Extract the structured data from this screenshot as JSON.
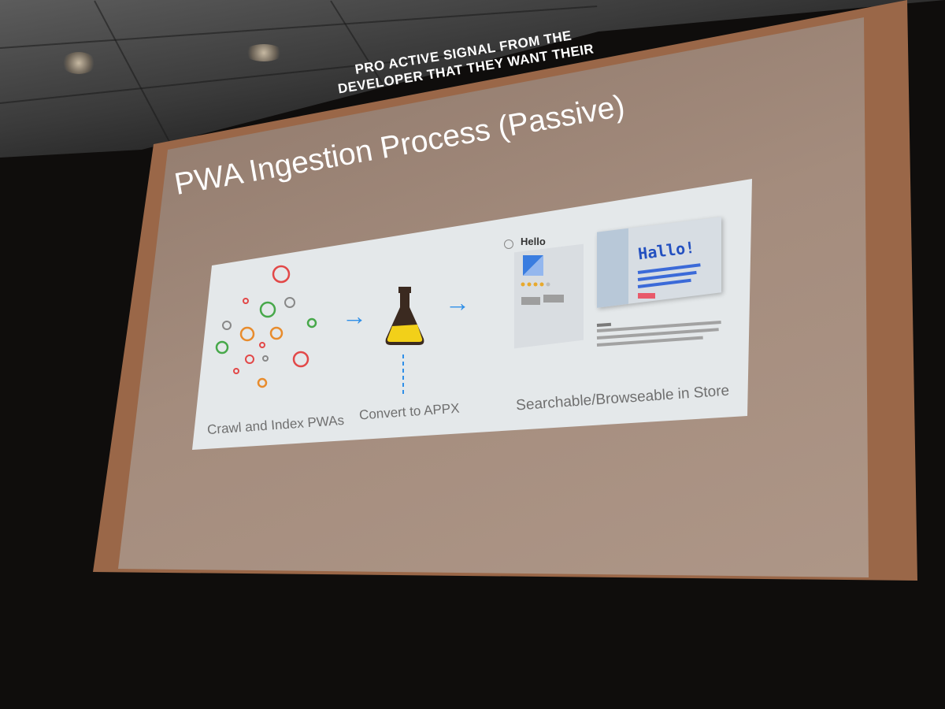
{
  "overlay_caption": {
    "line1": "PRO ACTIVE SIGNAL FROM THE",
    "line2": "DEVELOPER THAT THEY WANT THEIR"
  },
  "slide": {
    "title": "PWA Ingestion Process (Passive)",
    "steps": [
      {
        "label": "Crawl and Index PWAs",
        "icon": "circles-cluster-icon"
      },
      {
        "label": "Convert to APPX",
        "icon": "flask-icon"
      },
      {
        "label": "Searchable/Browseable  in Store",
        "icon": "store-listing-icon"
      }
    ],
    "store_listing": {
      "app_name": "Hello",
      "preview_text": "Hallo!"
    },
    "colors": {
      "arrow": "#2f8fe8",
      "flask_liquid": "#f2d019",
      "flask_body": "#3b2a20",
      "frame": "#9a6748"
    }
  }
}
